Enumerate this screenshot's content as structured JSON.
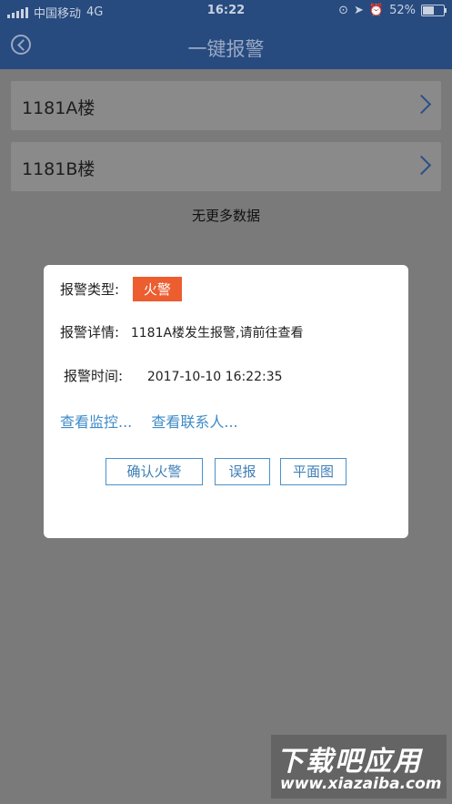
{
  "status_bar": {
    "carrier": "中国移动",
    "network": "4G",
    "time": "16:22",
    "battery": "52%",
    "battery_level": 0.52
  },
  "nav": {
    "title": "一键报警"
  },
  "list": {
    "items": [
      {
        "label": "1181A楼"
      },
      {
        "label": "1181B楼"
      }
    ],
    "no_more": "无更多数据"
  },
  "dialog": {
    "type_label": "报警类型:",
    "type_value": "火警",
    "detail_label": "报警详情:",
    "detail_value": "1181A楼发生报警,请前往查看",
    "time_label": "报警时间:",
    "time_value": "2017-10-10 16:22:35",
    "link_monitor": "查看监控...",
    "link_contacts": "查看联系人...",
    "buttons": {
      "confirm": "确认火警",
      "false_alarm": "误报",
      "floor_plan": "平面图"
    },
    "badge_color": "#ec5d30"
  },
  "watermark": {
    "title": "下载吧应用",
    "url": "www.xiazaiba.com"
  }
}
